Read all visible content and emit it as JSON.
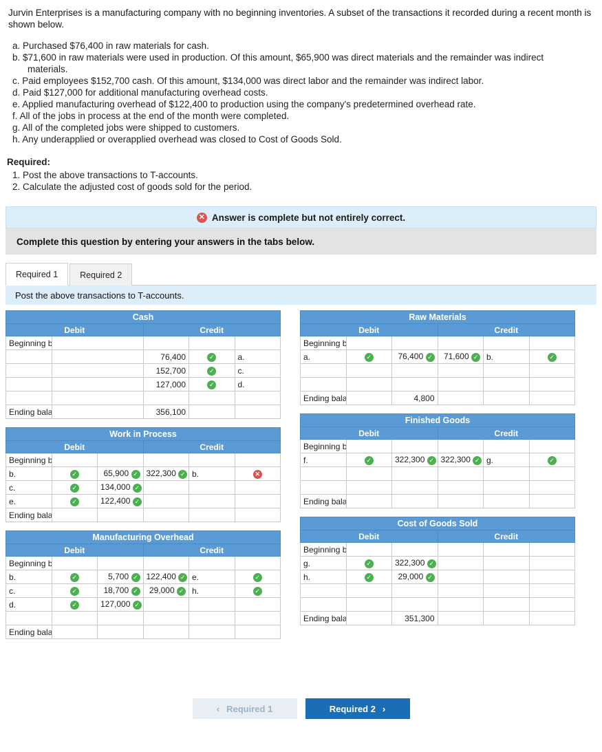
{
  "intro": {
    "paragraph": "Jurvin Enterprises is a manufacturing company with no beginning inventories. A subset of the transactions it recorded during a recent month is shown below."
  },
  "transactions": [
    {
      "label": "a.",
      "text": "Purchased $76,400 in raw materials for cash."
    },
    {
      "label": "b.",
      "text": "$71,600 in raw materials were used in production. Of this amount, $65,900 was direct materials and the remainder was indirect",
      "cont": "materials."
    },
    {
      "label": "c.",
      "text": "Paid employees $152,700 cash. Of this amount, $134,000 was direct labor and the remainder was indirect labor."
    },
    {
      "label": "d.",
      "text": "Paid $127,000 for additional manufacturing overhead costs."
    },
    {
      "label": "e.",
      "text": "Applied manufacturing overhead of $122,400 to production using the company's predetermined overhead rate."
    },
    {
      "label": "f.",
      "text": "All of the jobs in process at the end of the month were completed."
    },
    {
      "label": "g.",
      "text": "All of the completed jobs were shipped to customers."
    },
    {
      "label": "h.",
      "text": "Any underapplied or overapplied overhead was closed to Cost of Goods Sold."
    }
  ],
  "required": {
    "heading": "Required:",
    "items": [
      "1. Post the above transactions to T-accounts.",
      "2. Calculate the adjusted cost of goods sold for the period."
    ]
  },
  "alert": {
    "icon": "error-icon",
    "text": "Answer is complete but not entirely correct."
  },
  "instruction_bar": "Complete this question by entering your answers in the tabs below.",
  "tabs": [
    {
      "label": "Required 1",
      "active": true
    },
    {
      "label": "Required 2",
      "active": false
    }
  ],
  "tab_note": "Post the above transactions to T-accounts.",
  "column_headers": {
    "debit": "Debit",
    "credit": "Credit"
  },
  "labels": {
    "beginning": "Beginning balance",
    "ending": "Ending balance"
  },
  "accounts": [
    {
      "title": "Cash",
      "rows": [
        {
          "dlab": "Beginning balance",
          "dtick": "",
          "damt": "",
          "camt": "",
          "ctick": "",
          "clab": "",
          "ctick2": ""
        },
        {
          "dlab": "",
          "dtick": "",
          "damt": "",
          "camt": "76,400",
          "ctick": "ok",
          "clab": "a.",
          "ctick2": "ok"
        },
        {
          "dlab": "",
          "dtick": "",
          "damt": "",
          "camt": "152,700",
          "ctick": "ok",
          "clab": "c.",
          "ctick2": "ok"
        },
        {
          "dlab": "",
          "dtick": "",
          "damt": "",
          "camt": "127,000",
          "ctick": "ok",
          "clab": "d.",
          "ctick2": "ok"
        },
        {
          "dlab": "",
          "dtick": "",
          "damt": "",
          "camt": "",
          "ctick": "",
          "clab": "",
          "ctick2": ""
        },
        {
          "dlab": "Ending balance",
          "dtick": "",
          "damt": "",
          "camt": "356,100",
          "ctick": "",
          "clab": "",
          "ctick2": ""
        }
      ]
    },
    {
      "title": "Raw Materials",
      "rows": [
        {
          "dlab": "Beginning balance",
          "dtick": "",
          "damt": "",
          "camt": "",
          "ctick": "",
          "clab": "",
          "ctick2": ""
        },
        {
          "dlab": "a.",
          "dtick": "ok",
          "damt": "76,400",
          "damt_tick": "ok",
          "camt": "71,600",
          "ctick": "ok",
          "clab": "b.",
          "ctick2": "ok"
        },
        {
          "dlab": "",
          "dtick": "",
          "damt": "",
          "camt": "",
          "ctick": "",
          "clab": "",
          "ctick2": ""
        },
        {
          "dlab": "",
          "dtick": "",
          "damt": "",
          "camt": "",
          "ctick": "",
          "clab": "",
          "ctick2": ""
        },
        {
          "dlab": "Ending balance",
          "dtick": "",
          "damt": "4,800",
          "camt": "",
          "ctick": "",
          "clab": "",
          "ctick2": ""
        }
      ]
    },
    {
      "title": "Work in Process",
      "rows": [
        {
          "dlab": "Beginning balance",
          "dtick": "",
          "damt": "",
          "camt": "",
          "ctick": "",
          "clab": "",
          "ctick2": ""
        },
        {
          "dlab": "b.",
          "dtick": "ok",
          "damt": "65,900",
          "damt_tick": "ok",
          "camt": "322,300",
          "ctick": "ok",
          "clab": "b.",
          "ctick2": "bad"
        },
        {
          "dlab": "c.",
          "dtick": "ok",
          "damt": "134,000",
          "damt_tick": "ok",
          "camt": "",
          "ctick": "",
          "clab": "",
          "ctick2": ""
        },
        {
          "dlab": "e.",
          "dtick": "ok",
          "damt": "122,400",
          "damt_tick": "ok",
          "camt": "",
          "ctick": "",
          "clab": "",
          "ctick2": ""
        },
        {
          "dlab": "Ending balance",
          "dtick": "",
          "damt": "",
          "camt": "",
          "ctick": "",
          "clab": "",
          "ctick2": ""
        }
      ]
    },
    {
      "title": "Finished Goods",
      "rows": [
        {
          "dlab": "Beginning balance",
          "dtick": "",
          "damt": "",
          "camt": "",
          "ctick": "",
          "clab": "",
          "ctick2": ""
        },
        {
          "dlab": "f.",
          "dtick": "ok",
          "damt": "322,300",
          "damt_tick": "ok",
          "camt": "322,300",
          "ctick": "ok",
          "clab": "g.",
          "ctick2": "ok"
        },
        {
          "dlab": "",
          "dtick": "",
          "damt": "",
          "camt": "",
          "ctick": "",
          "clab": "",
          "ctick2": ""
        },
        {
          "dlab": "",
          "dtick": "",
          "damt": "",
          "camt": "",
          "ctick": "",
          "clab": "",
          "ctick2": ""
        },
        {
          "dlab": "Ending balance",
          "dtick": "",
          "damt": "",
          "camt": "",
          "ctick": "",
          "clab": "",
          "ctick2": ""
        }
      ]
    },
    {
      "title": "Manufacturing Overhead",
      "rows": [
        {
          "dlab": "Beginning balance",
          "dtick": "",
          "damt": "",
          "camt": "",
          "ctick": "",
          "clab": "",
          "ctick2": ""
        },
        {
          "dlab": "b.",
          "dtick": "ok",
          "damt": "5,700",
          "damt_tick": "ok",
          "camt": "122,400",
          "ctick": "ok",
          "clab": "e.",
          "ctick2": "ok"
        },
        {
          "dlab": "c.",
          "dtick": "ok",
          "damt": "18,700",
          "damt_tick": "ok",
          "camt": "29,000",
          "ctick": "ok",
          "clab": "h.",
          "ctick2": "ok"
        },
        {
          "dlab": "d.",
          "dtick": "ok",
          "damt": "127,000",
          "damt_tick": "ok",
          "camt": "",
          "ctick": "",
          "clab": "",
          "ctick2": ""
        },
        {
          "dlab": "",
          "dtick": "",
          "damt": "",
          "camt": "",
          "ctick": "",
          "clab": "",
          "ctick2": ""
        },
        {
          "dlab": "Ending balance",
          "dtick": "",
          "damt": "",
          "camt": "",
          "ctick": "",
          "clab": "",
          "ctick2": ""
        }
      ]
    },
    {
      "title": "Cost of Goods Sold",
      "rows": [
        {
          "dlab": "Beginning balance",
          "dtick": "",
          "damt": "",
          "camt": "",
          "ctick": "",
          "clab": "",
          "ctick2": ""
        },
        {
          "dlab": "g.",
          "dtick": "ok",
          "damt": "322,300",
          "damt_tick": "ok",
          "camt": "",
          "ctick": "",
          "clab": "",
          "ctick2": ""
        },
        {
          "dlab": "h.",
          "dtick": "ok",
          "damt": "29,000",
          "damt_tick": "ok",
          "camt": "",
          "ctick": "",
          "clab": "",
          "ctick2": ""
        },
        {
          "dlab": "",
          "dtick": "",
          "damt": "",
          "camt": "",
          "ctick": "",
          "clab": "",
          "ctick2": ""
        },
        {
          "dlab": "",
          "dtick": "",
          "damt": "",
          "camt": "",
          "ctick": "",
          "clab": "",
          "ctick2": ""
        },
        {
          "dlab": "Ending balance",
          "dtick": "",
          "damt": "351,300",
          "camt": "",
          "ctick": "",
          "clab": "",
          "ctick2": ""
        }
      ]
    }
  ],
  "nav": {
    "prev_label": "Required 1",
    "next_label": "Required 2",
    "prev_icon": "chevron-left-icon",
    "next_icon": "chevron-right-icon"
  },
  "colors": {
    "header_blue": "#5b9bd5",
    "note_blue": "#ddeefb",
    "ok_green": "#4caf50",
    "error_red": "#d9534f",
    "primary_button": "#1c6eb4"
  }
}
